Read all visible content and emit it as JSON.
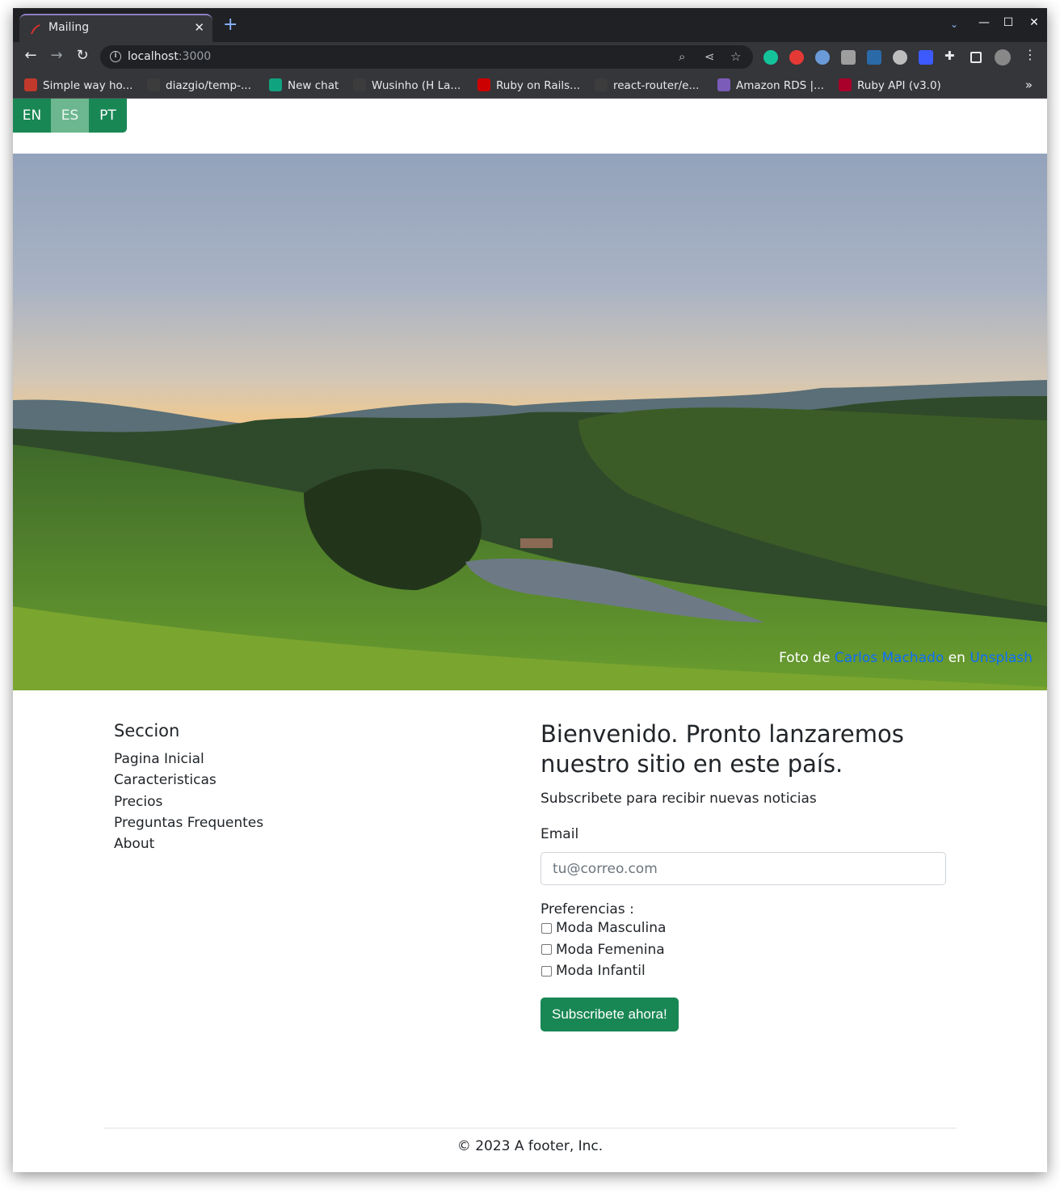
{
  "browser": {
    "tab": {
      "title": "Mailing",
      "close": "✕"
    },
    "new_tab": "+",
    "address": {
      "host": "localhost",
      "port": ":3000"
    },
    "window_controls": {
      "minimize": "—",
      "maximize": "☐",
      "close": "✕"
    },
    "bookmarks": [
      {
        "label": "Simple way ho...",
        "icon": "bookmark-favicon",
        "color": "#c0392b"
      },
      {
        "label": "diazgio/temp-...",
        "icon": "github-icon",
        "color": "#3c3c3c"
      },
      {
        "label": "New chat",
        "icon": "openai-icon",
        "color": "#10a37f"
      },
      {
        "label": "Wusinho (H La...",
        "icon": "github-icon",
        "color": "#3c3c3c"
      },
      {
        "label": "Ruby on Rails...",
        "icon": "rails-icon",
        "color": "#cc0000"
      },
      {
        "label": "react-router/e...",
        "icon": "github-icon",
        "color": "#3c3c3c"
      },
      {
        "label": "Amazon RDS |...",
        "icon": "heroku-icon",
        "color": "#7b5cb8"
      },
      {
        "label": "Ruby API (v3.0)",
        "icon": "ruby-icon",
        "color": "#a8002b"
      }
    ],
    "bookmarks_more": "»"
  },
  "page": {
    "languages": [
      {
        "code": "EN",
        "active": false
      },
      {
        "code": "ES",
        "active": true
      },
      {
        "code": "PT",
        "active": false
      }
    ],
    "hero": {
      "credit_prefix": "Foto de",
      "credit_author": "Carlos Machado",
      "credit_mid": "en",
      "credit_source": "Unsplash"
    },
    "sidebar": {
      "title": "Seccion",
      "links": [
        "Pagina Inicial",
        "Caracteristicas",
        "Precios",
        "Preguntas Frequentes",
        "About"
      ]
    },
    "main": {
      "heading": "Bienvenido. Pronto lanzaremos nuestro sitio en este país.",
      "lead": "Subscribete para recibir nuevas noticias",
      "email_label": "Email",
      "email_placeholder": "tu@correo.com",
      "preferences_label": "Preferencias :",
      "options": [
        "Moda Masculina",
        "Moda Femenina",
        "Moda Infantil"
      ],
      "submit": "Subscribete ahora!"
    },
    "footer": "© 2023 A footer, Inc.",
    "colors": {
      "primary": "#198754",
      "link": "#0d6efd"
    }
  }
}
